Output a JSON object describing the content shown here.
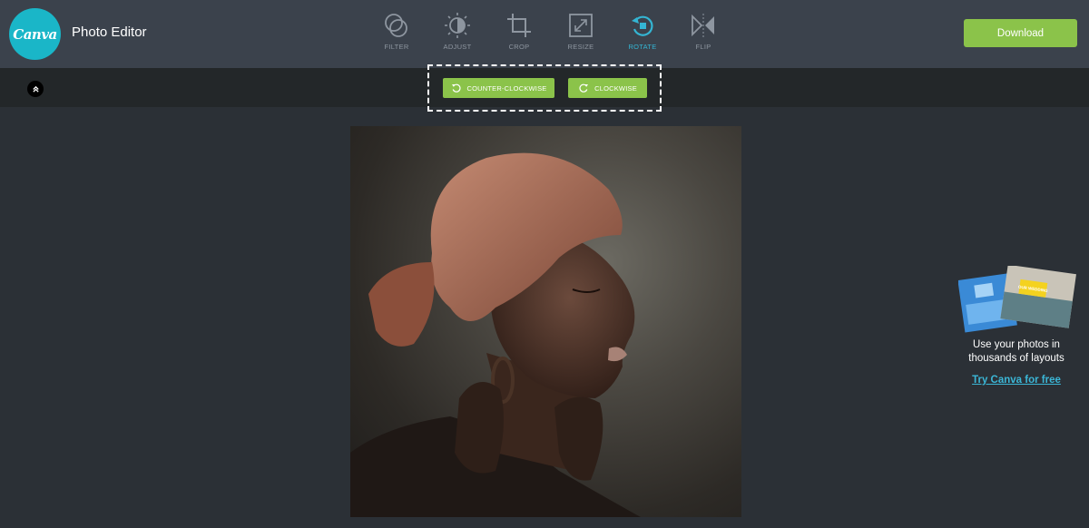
{
  "header": {
    "logo_text": "Canva",
    "app_title": "Photo Editor",
    "download_label": "Download"
  },
  "tools": [
    {
      "label": "FILTER",
      "icon": "filter-icon"
    },
    {
      "label": "ADJUST",
      "icon": "adjust-icon"
    },
    {
      "label": "CROP",
      "icon": "crop-icon"
    },
    {
      "label": "RESIZE",
      "icon": "resize-icon"
    },
    {
      "label": "ROTATE",
      "icon": "rotate-icon",
      "active": true
    },
    {
      "label": "FLIP",
      "icon": "flip-icon"
    }
  ],
  "rotate_options": {
    "counter_clockwise_label": "COUNTER-CLOCKWISE",
    "clockwise_label": "CLOCKWISE"
  },
  "promo": {
    "text": "Use your photos in thousands of layouts",
    "link_label": "Try Canva for free",
    "card_label": "OUR WEDDING"
  },
  "colors": {
    "accent_green": "#8bc34a",
    "active_blue": "#34b5d3",
    "header_bg": "#3b424c",
    "canvas_bg": "#2b3036"
  }
}
